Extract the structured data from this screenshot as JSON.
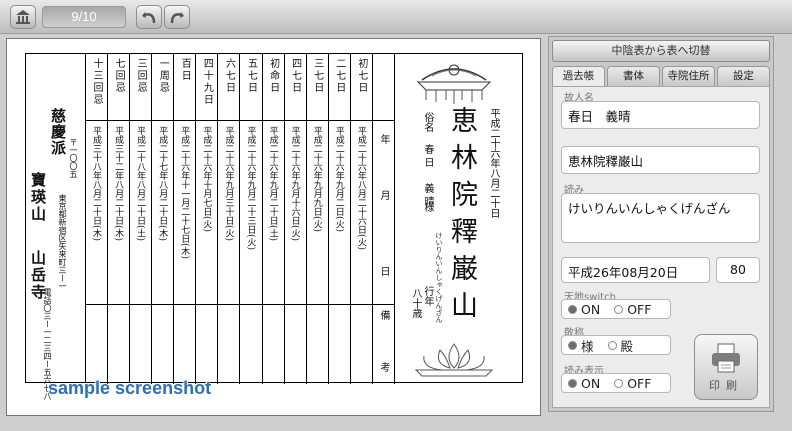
{
  "toolbar": {
    "home_icon": "home-icon",
    "page_counter": "9/10",
    "undo_icon": "undo-icon",
    "redo_icon": "redo-icon"
  },
  "temple": {
    "sect": "慈慶派",
    "mountain": "寶瑛山",
    "name": "山岳寺",
    "postal": "〒一〇〇五",
    "address": "東京都新宿区矢来町三ー一",
    "phone": "電話〇三ー一二三四ー五六七八"
  },
  "memorial_table": [
    {
      "name": "十三回忌",
      "date": "平成三十八年八月二十日(木)"
    },
    {
      "name": "七回忌",
      "date": "平成三十二年八月二十日(木)"
    },
    {
      "name": "三回忌",
      "date": "平成二十八年八月二十日(土)"
    },
    {
      "name": "一周忌",
      "date": "平成二十七年八月二十日(木)"
    },
    {
      "name": "百日",
      "date": "平成二十六年十一月二十七日(木)"
    },
    {
      "name": "四十九日",
      "date": "平成二十六年十月七日(火)"
    },
    {
      "name": "六七日",
      "date": "平成二十六年九月三十日(火)"
    },
    {
      "name": "五七日",
      "date": "平成二十六年九月二十三日(火)"
    },
    {
      "name": "初命日",
      "date": "平成二十六年九月二十日(土)"
    },
    {
      "name": "四七日",
      "date": "平成二十六年九月十六日(火)"
    },
    {
      "name": "三七日",
      "date": "平成二十六年九月九日(火)"
    },
    {
      "name": "二七日",
      "date": "平成二十六年九月二日(火)"
    },
    {
      "name": "初七日",
      "date": "平成二十六年八月二十六日(火)"
    }
  ],
  "remarks": {
    "y": "年",
    "m": "月",
    "d": "日",
    "bi": "備",
    "ko": "考"
  },
  "ihai": {
    "date": "平成二十六年八月二十日",
    "kaimyo": "恵林院釋巌山",
    "reading": "けいりんいんしゃくげんざん",
    "secular_label": "俗名",
    "secular_name": "春日　義晴",
    "honorific": "様",
    "age_label": "行年",
    "age": "八十歳"
  },
  "panel": {
    "switch_button": "中陰表から表へ切替",
    "tabs": [
      "過去帳",
      "書体",
      "寺院住所",
      "設定"
    ],
    "deceased_label": "故人名",
    "deceased_value": "春日　義晴",
    "kaimyo_value": "恵林院釋巌山",
    "reading_label": "読み",
    "reading_value": "けいりんいんしゃくげんざん",
    "date_value": "平成26年08月20日",
    "age_value": "80",
    "tenchi_label": "天地switch",
    "tenchi_on": "ON",
    "tenchi_off": "OFF",
    "honorific_label": "敬称",
    "honorific_sama": "様",
    "honorific_dono": "殿",
    "reading_display_label": "読み表示",
    "reading_on": "ON",
    "reading_off": "OFF",
    "print_label": "印刷"
  },
  "watermark": "sample screenshot"
}
